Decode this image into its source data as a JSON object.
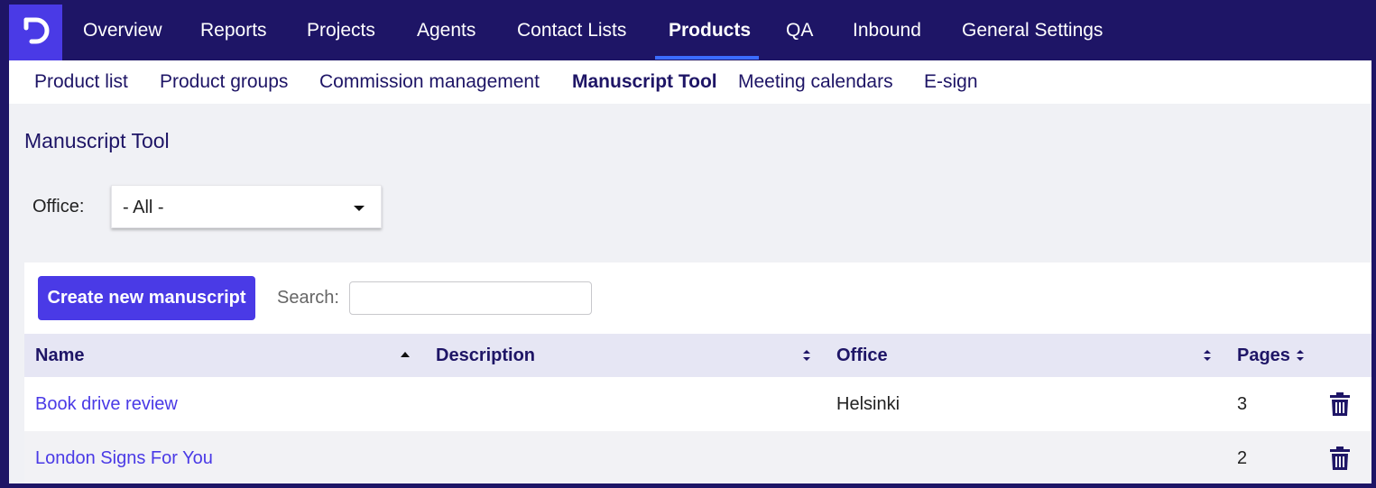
{
  "topnav": {
    "items": [
      {
        "label": "Overview"
      },
      {
        "label": "Reports"
      },
      {
        "label": "Projects"
      },
      {
        "label": "Agents"
      },
      {
        "label": "Contact Lists"
      },
      {
        "label": "Products",
        "active": true
      },
      {
        "label": "QA"
      },
      {
        "label": "Inbound"
      },
      {
        "label": "General Settings"
      }
    ],
    "logo_icon": "app-logo-icon",
    "accent_color": "#3b6cff"
  },
  "subnav": {
    "items": [
      {
        "label": "Product list"
      },
      {
        "label": "Product groups"
      },
      {
        "label": "Commission management"
      },
      {
        "label": "Manuscript Tool",
        "active": true
      },
      {
        "label": "Meeting calendars"
      },
      {
        "label": "E-sign"
      }
    ]
  },
  "page": {
    "title": "Manuscript Tool",
    "office_filter": {
      "label": "Office:",
      "selected": "- All -"
    }
  },
  "toolbar": {
    "create_label": "Create new manuscript",
    "search_label": "Search:",
    "search_value": ""
  },
  "table": {
    "columns": [
      {
        "label": "Name",
        "sort": "asc"
      },
      {
        "label": "Description",
        "sort": "both"
      },
      {
        "label": "Office",
        "sort": "both"
      },
      {
        "label": "Pages",
        "sort": "both"
      }
    ],
    "rows": [
      {
        "name": "Book drive review",
        "description": "",
        "office": "Helsinki",
        "pages": "3"
      },
      {
        "name": "London Signs For You",
        "description": "",
        "office": "",
        "pages": "2"
      }
    ],
    "row_action_icon": "trash-icon"
  },
  "colors": {
    "brand_dark": "#1e1566",
    "brand_primary": "#4a3ae6"
  }
}
